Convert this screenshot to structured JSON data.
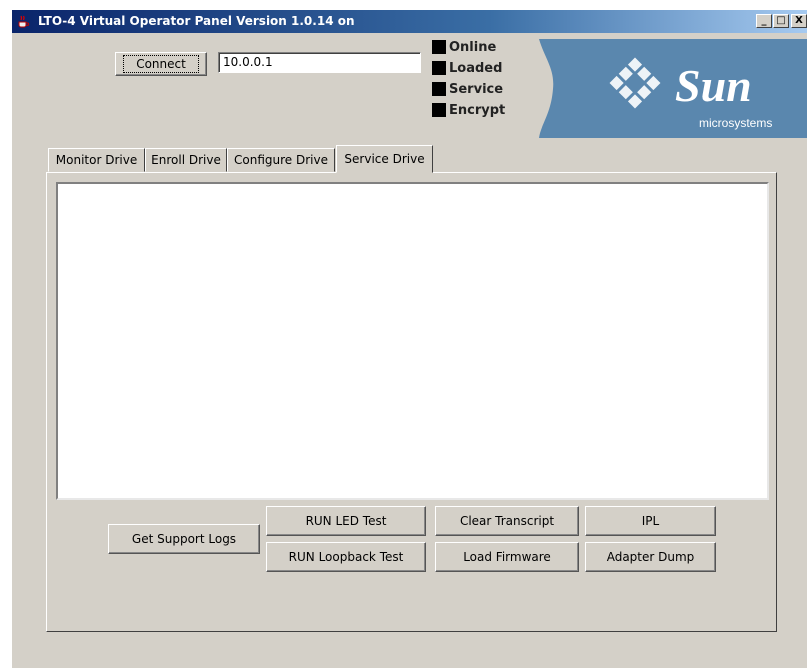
{
  "window": {
    "title": "LTO-4 Virtual Operator Panel Version 1.0.14 on",
    "controls": {
      "minimize": "_",
      "maximize": "□",
      "close": "X"
    }
  },
  "connection": {
    "connect_label": "Connect",
    "address_value": "10.0.0.1"
  },
  "indicators": [
    {
      "label": "Online",
      "state_color": "#000000"
    },
    {
      "label": "Loaded",
      "state_color": "#000000"
    },
    {
      "label": "Service",
      "state_color": "#000000"
    },
    {
      "label": "Encrypt",
      "state_color": "#000000"
    }
  ],
  "logo": {
    "brand": "Sun",
    "sub": "microsystems",
    "icon": "sun-logo-icon",
    "background": "#5a87ae"
  },
  "tabs": [
    {
      "label": "Monitor Drive"
    },
    {
      "label": "Enroll Drive"
    },
    {
      "label": "Configure Drive"
    },
    {
      "label": "Service Drive",
      "active": true
    }
  ],
  "service": {
    "transcript_text": "",
    "buttons": {
      "get_support_logs": "Get Support Logs",
      "run_led_test": "RUN LED Test",
      "run_loopback_test": "RUN Loopback Test",
      "clear_transcript": "Clear Transcript",
      "load_firmware": "Load Firmware",
      "ipl": "IPL",
      "adapter_dump": "Adapter Dump"
    }
  }
}
